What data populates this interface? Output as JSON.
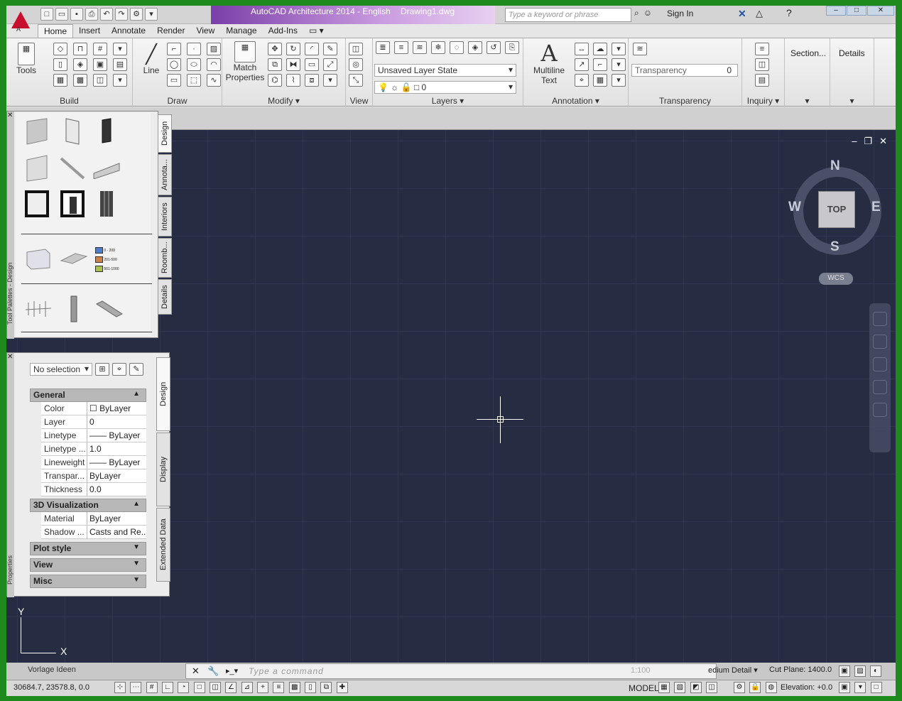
{
  "title_bar": {
    "app_title": "AutoCAD Architecture 2014 - English",
    "document": "Drawing1.dwg",
    "search_placeholder": "Type a keyword or phrase",
    "sign_in": "Sign In",
    "app_logo_letter": "A"
  },
  "ribbon_tabs": [
    "Home",
    "Insert",
    "Annotate",
    "Render",
    "View",
    "Manage",
    "Add-Ins"
  ],
  "ribbon": {
    "tools_label": "Tools",
    "line_label": "Line",
    "match_properties_label": "Match\nProperties",
    "match_label": "Match",
    "properties_label": "Properties",
    "layer_state": "Unsaved Layer State",
    "layer_current": "0",
    "multiline_letter": "A",
    "multiline_label": "Multiline",
    "text_label": "Text",
    "transparency_label": "Transparency",
    "transparency_value": "0",
    "section_label": "Section...",
    "details_label": "Details",
    "panels": [
      "Build",
      "Draw",
      "Modify",
      "View",
      "Layers",
      "Annotation",
      "Transparency",
      "Inquiry"
    ]
  },
  "viewcube": {
    "top": "TOP",
    "north": "N",
    "south": "S",
    "east": "E",
    "west": "W",
    "wcs": "WCS"
  },
  "ucs": {
    "y": "Y",
    "x": "X"
  },
  "tool_palette": {
    "tabs": [
      "Design",
      "Annota...",
      "Interiors",
      "Roomb...",
      "Details"
    ],
    "legend": [
      "0 - 200",
      "201-500",
      "501-1000"
    ],
    "legend_colors": [
      "#4a7fd0",
      "#d08040",
      "#a8c048"
    ],
    "side_label": "Tool Palettes - Design"
  },
  "properties": {
    "selection": "No selection",
    "tabs": [
      "Design",
      "Display",
      "Extended Data"
    ],
    "side_label": "Properties",
    "sections": {
      "general": "General",
      "viz": "3D Visualization",
      "plot": "Plot style",
      "view": "View",
      "misc": "Misc"
    },
    "general_rows": [
      {
        "k": "Color",
        "v": "ByLayer"
      },
      {
        "k": "Layer",
        "v": "0"
      },
      {
        "k": "Linetype",
        "v": "ByLayer"
      },
      {
        "k": "Linetype ...",
        "v": "1.0"
      },
      {
        "k": "Lineweight",
        "v": "ByLayer"
      },
      {
        "k": "Transpar...",
        "v": "ByLayer"
      },
      {
        "k": "Thickness",
        "v": "0.0"
      }
    ],
    "viz_rows": [
      {
        "k": "Material",
        "v": "ByLayer"
      },
      {
        "k": "Shadow ...",
        "v": "Casts and Re..."
      }
    ]
  },
  "command_line": {
    "layout_label": "Vorlage Ideen",
    "placeholder": "Type a command",
    "scale": "1:100",
    "detail": "edium Detail",
    "cut_plane": "Cut Plane:  1400.0"
  },
  "status_bar": {
    "coords": "30684.7, 23578.8, 0.0",
    "model": "MODEL",
    "elevation": "Elevation:  +0.0"
  }
}
